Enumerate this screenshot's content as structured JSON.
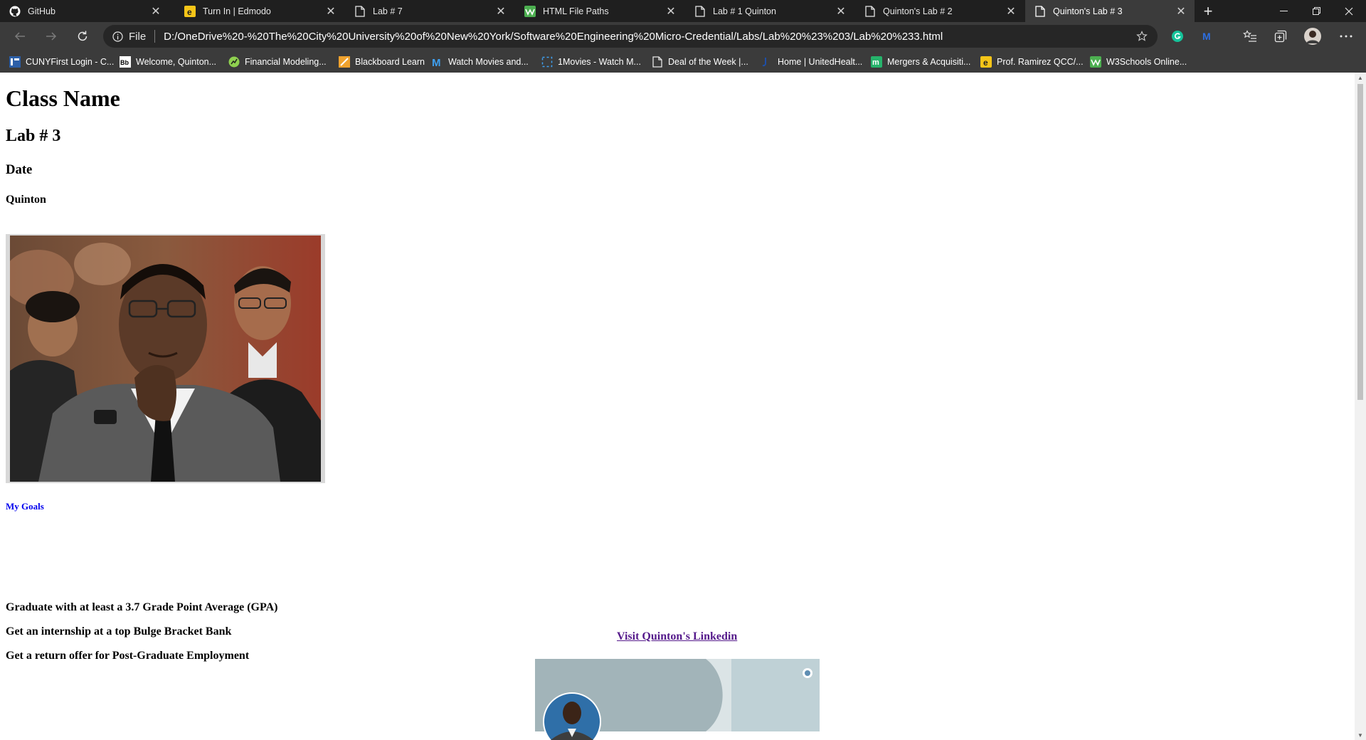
{
  "browser": {
    "tabs": [
      {
        "title": "GitHub",
        "icon": "github-icon",
        "active": false
      },
      {
        "title": "Turn In | Edmodo",
        "icon": "edmodo-icon",
        "active": false
      },
      {
        "title": "Lab # 7",
        "icon": "document-icon",
        "active": false
      },
      {
        "title": "HTML File Paths",
        "icon": "w3schools-icon",
        "active": false
      },
      {
        "title": "Lab # 1 Quinton",
        "icon": "document-icon",
        "active": false
      },
      {
        "title": "Quinton's Lab # 2",
        "icon": "document-icon",
        "active": false
      },
      {
        "title": "Quinton's Lab # 3",
        "icon": "document-icon",
        "active": true
      }
    ],
    "address": {
      "scheme_label": "File",
      "url": "D:/OneDrive%20-%20The%20City%20University%20of%20New%20York/Software%20Engineering%20Micro-Credential/Labs/Lab%20%23%203/Lab%20%233.html"
    },
    "bookmarks": [
      {
        "label": "CUNYFirst Login - C...",
        "icon": "cunyfirst-icon"
      },
      {
        "label": "Welcome, Quinton...",
        "icon": "blackboard-icon"
      },
      {
        "label": "Financial Modeling...",
        "icon": "fmp-icon"
      },
      {
        "label": "Blackboard Learn",
        "icon": "blackboard-learn-icon"
      },
      {
        "label": "Watch Movies and...",
        "icon": "movies-icon"
      },
      {
        "label": "1Movies - Watch M...",
        "icon": "dashed-square-icon"
      },
      {
        "label": "Deal of the Week |...",
        "icon": "document-icon"
      },
      {
        "label": "Home | UnitedHealt...",
        "icon": "uhc-icon"
      },
      {
        "label": "Mergers & Acquisiti...",
        "icon": "m-icon"
      },
      {
        "label": "Prof. Ramirez QCC/...",
        "icon": "edmodo-icon"
      },
      {
        "label": "W3Schools Online...",
        "icon": "w3schools-icon"
      }
    ],
    "colors": {
      "tab_bg": "#1f1f1f",
      "toolbar_bg": "#3b3b3b",
      "omnibox_bg": "#262626"
    }
  },
  "page": {
    "class_name": "Class Name",
    "lab_number": "Lab # 3",
    "date_label": "Date",
    "author": "Quinton",
    "photo_alt": "profile-photo",
    "goals_link": "My Goals",
    "goals": [
      "Graduate with at least a 3.7 Grade Point Average (GPA)",
      "Get an internship at a top Bulge Bracket Bank",
      "Get a return offer for Post-Graduate Employment"
    ],
    "linkedin_link": "Visit Quinton's Linkedin"
  }
}
